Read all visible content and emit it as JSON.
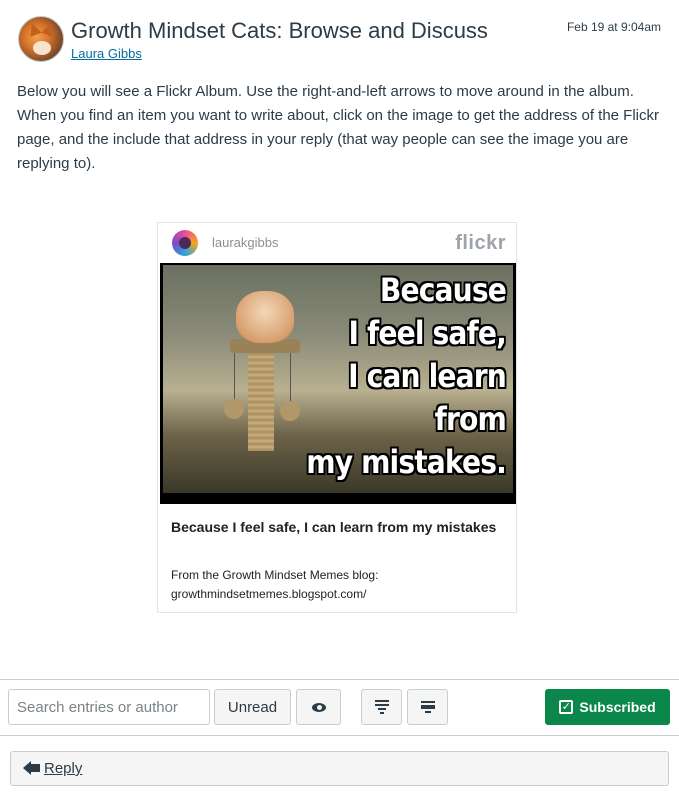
{
  "header": {
    "title": "Growth Mindset Cats: Browse and Discuss",
    "author": "Laura Gibbs",
    "date": "Feb 19 at 9:04am"
  },
  "body_text": "Below you will see a Flickr Album. Use the right-and-left arrows to move around in the album. When you find an item you want to write about, click on the image to get the address of the Flickr page, and the include that address in your reply (that way people can see the image you are replying to).",
  "embed": {
    "username": "laurakgibbs",
    "logo": "flickr",
    "meme_lines": [
      "Because",
      "I feel safe,",
      "I can learn",
      "from",
      "my mistakes."
    ],
    "caption_title": "Because I feel safe, I can learn from my mistakes",
    "caption_desc": "From the Growth Mindset Memes blog: growthmindsetmemes.blogspot.com/"
  },
  "toolbar": {
    "search_placeholder": "Search entries or author",
    "unread_label": "Unread",
    "subscribed_label": "Subscribed"
  },
  "reply": {
    "label": "Reply"
  },
  "colors": {
    "link": "#0770a3",
    "subscribed_bg": "#0b874b",
    "text": "#2d3b45"
  }
}
